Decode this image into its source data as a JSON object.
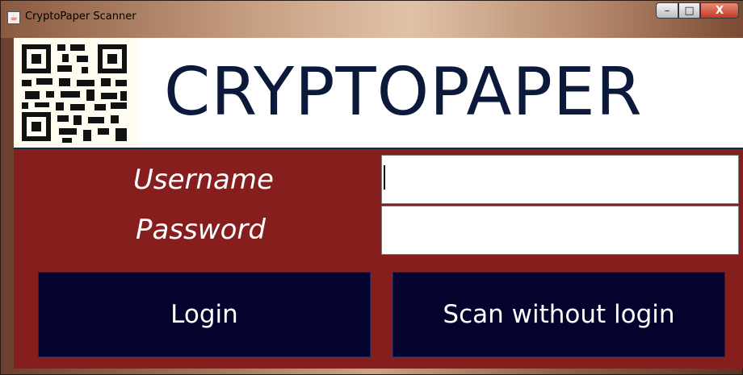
{
  "window": {
    "title": "CryptoPaper Scanner",
    "app_icon": "java-icon",
    "controls": {
      "minimize": "–",
      "maximize": "□",
      "close": "X"
    }
  },
  "logo": {
    "text": "CRYPTOPAPER",
    "qr_icon": "qr-code-icon"
  },
  "form": {
    "username_label": "Username",
    "password_label": "Password",
    "username_value": "",
    "password_value": ""
  },
  "buttons": {
    "login": "Login",
    "scan_without_login": "Scan without login"
  },
  "colors": {
    "panel": "#871e1e",
    "button": "#03032e",
    "logo_text": "#0b1a3a"
  }
}
